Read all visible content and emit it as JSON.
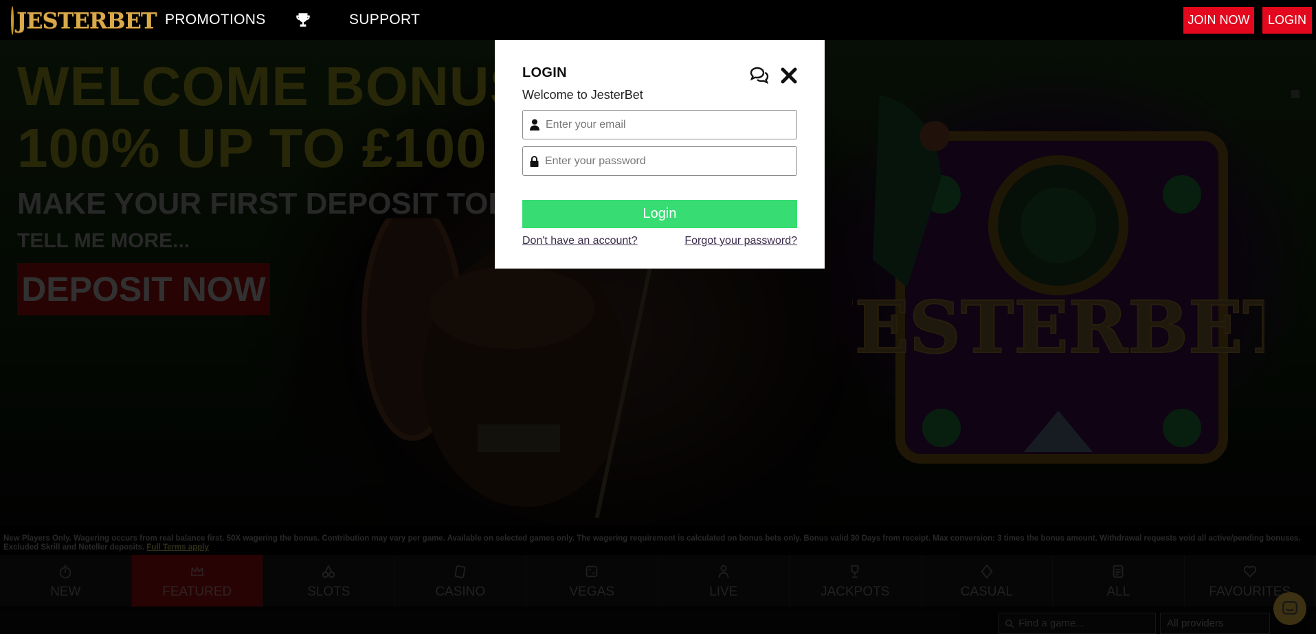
{
  "nav": {
    "logo_text": "JESTERBET",
    "promotions": "PROMOTIONS",
    "trophy_icon": "trophy-icon",
    "support": "SUPPORT",
    "join_now": "JOIN NOW",
    "login": "LOGIN"
  },
  "hero": {
    "title_line1": "WELCOME BONUS",
    "title_line2": "100% UP TO £100",
    "subtitle": "MAKE YOUR FIRST DEPOSIT TODAY",
    "tell_more": "TELL ME MORE...",
    "deposit_button": "DEPOSIT NOW",
    "art_logo_text": "JESTERBET"
  },
  "terms": {
    "text": "New Players Only. Wagering occurs from real balance first. 50X wagering the bonus. Contribution may vary per game. Available on selected games only. The wagering requirement is calculated on bonus bets only. Bonus valid 30 Days from receipt. Max conversion: 3 times the bonus amount. Withdrawal requests void all active/pending bonuses. Excluded Skrill and Neteller deposits.",
    "link": "Full Terms apply"
  },
  "categories": [
    {
      "label": "NEW",
      "icon": "stopwatch-icon"
    },
    {
      "label": "FEATURED",
      "icon": "crown-icon"
    },
    {
      "label": "SLOTS",
      "icon": "cherries-icon"
    },
    {
      "label": "CASINO",
      "icon": "cards-icon"
    },
    {
      "label": "VEGAS",
      "icon": "dice-icon"
    },
    {
      "label": "LIVE",
      "icon": "dealer-icon"
    },
    {
      "label": "JACKPOTS",
      "icon": "trophy-icon"
    },
    {
      "label": "CASUAL",
      "icon": "diamond-icon"
    },
    {
      "label": "ALL",
      "icon": "list-icon"
    },
    {
      "label": "FAVOURITES",
      "icon": "heart-icon"
    }
  ],
  "active_category": "FEATURED",
  "search": {
    "placeholder": "Find a game..."
  },
  "providers": {
    "selected": "All providers"
  },
  "modal": {
    "title": "LOGIN",
    "welcome": "Welcome to JesterBet",
    "email_placeholder": "Enter your email",
    "password_placeholder": "Enter your password",
    "login_button": "Login",
    "no_account_link": "Don't have an account?",
    "forgot_link": "Forgot your password?"
  },
  "colors": {
    "brand_red": "#e3081d",
    "login_green": "#37dc72",
    "logo_gold": "#d9a94a"
  }
}
